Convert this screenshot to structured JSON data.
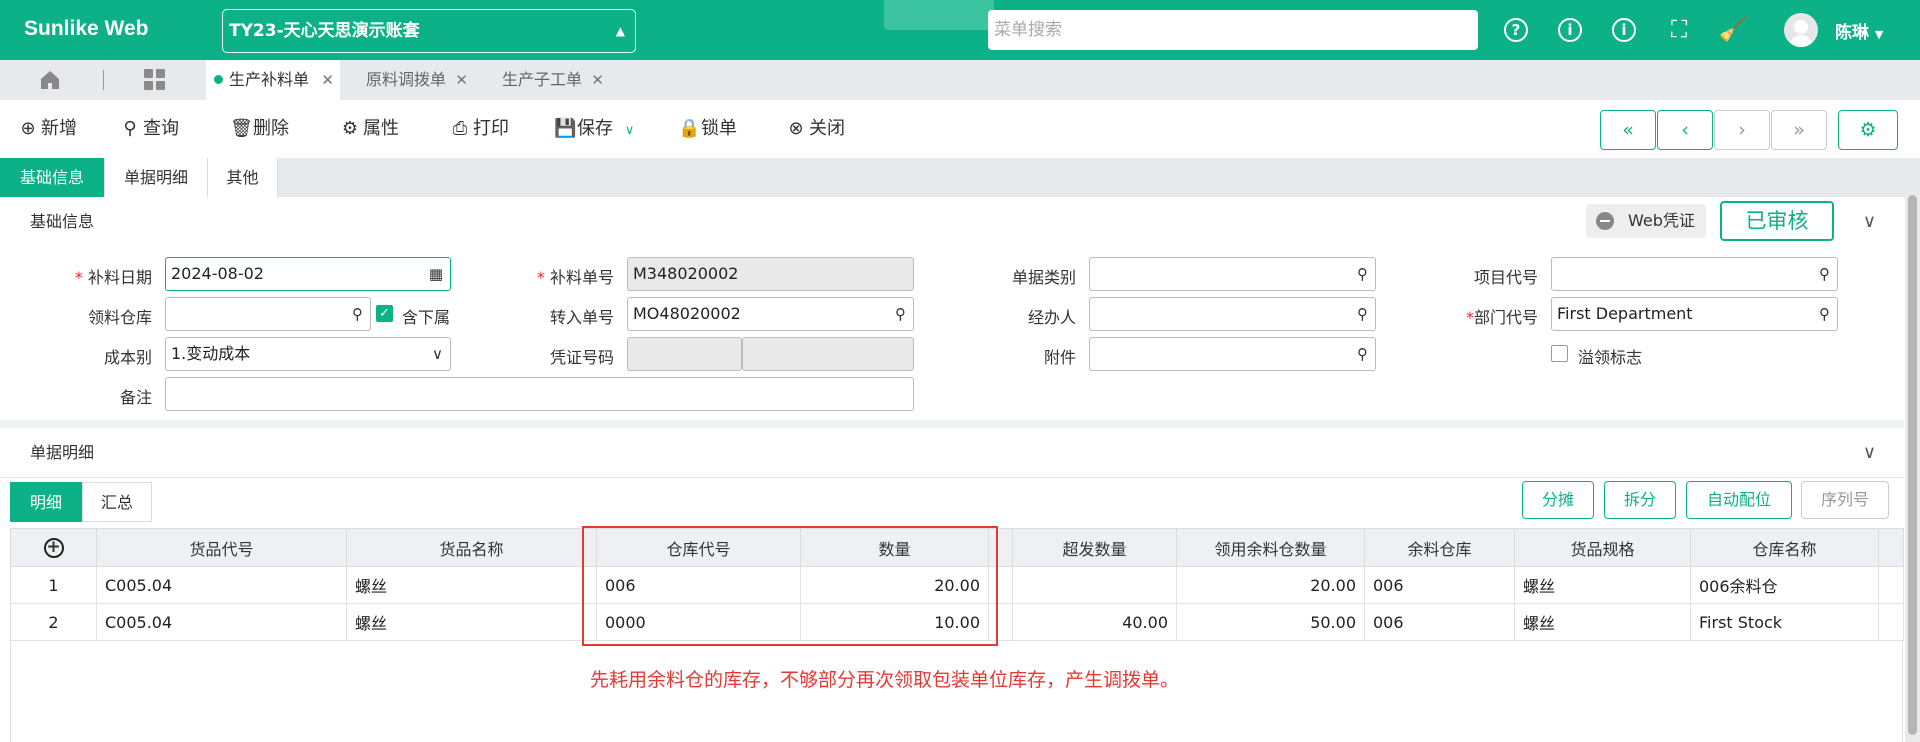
{
  "brand": "Sunlike Web",
  "account": "TY23-天心天思演示账套",
  "menu_search_placeholder": "菜单搜索",
  "user_name": "陈琳",
  "page_tabs": [
    {
      "label": "生产补料单",
      "active": true
    },
    {
      "label": "原料调拨单",
      "active": false
    },
    {
      "label": "生产子工单",
      "active": false
    }
  ],
  "toolbar": {
    "new": "新增",
    "query": "查询",
    "delete": "删除",
    "props": "属性",
    "print": "打印",
    "save": "保存",
    "lock": "锁单",
    "close": "关闭"
  },
  "form_tabs": [
    "基础信息",
    "单据明细",
    "其他"
  ],
  "basic_section": {
    "title": "基础信息",
    "web_voucher": "Web凭证",
    "status": "已审核"
  },
  "fields": {
    "date_label": "补料日期",
    "date_value": "2024-08-02",
    "warehouse_label": "领料仓库",
    "warehouse_value": "",
    "include_sub_label": "含下属",
    "cost_label": "成本别",
    "cost_value": "1.变动成本",
    "remark_label": "备注",
    "remark_value": "",
    "order_no_label": "补料单号",
    "order_no_value": "M348020002",
    "transfer_label": "转入单号",
    "transfer_value": "MO48020002",
    "voucher_label": "凭证号码",
    "doc_type_label": "单据类别",
    "handler_label": "经办人",
    "attach_label": "附件",
    "project_label": "项目代号",
    "dept_label": "部门代号",
    "dept_value": "First Department",
    "overflow_label": "溢领标志"
  },
  "detail_section": {
    "title": "单据明细",
    "tabs": [
      "明细",
      "汇总"
    ],
    "buttons": [
      "分摊",
      "拆分",
      "自动配位",
      "序列号"
    ]
  },
  "table": {
    "headers": [
      "货品代号",
      "货品名称",
      "仓库代号",
      "数量",
      "",
      "超发数量",
      "领用余料仓数量",
      "余料仓库",
      "货品规格",
      "仓库名称"
    ],
    "rows": [
      {
        "no": "1",
        "code": "C005.04",
        "name": "螺丝",
        "wh": "006",
        "qty": "20.00",
        "over": "",
        "rest": "20.00",
        "rest_wh": "006",
        "spec": "螺丝",
        "wh_name": "006余料仓"
      },
      {
        "no": "2",
        "code": "C005.04",
        "name": "螺丝",
        "wh": "0000",
        "qty": "10.00",
        "over": "40.00",
        "rest": "50.00",
        "rest_wh": "006",
        "spec": "螺丝",
        "wh_name": "First Stock"
      }
    ]
  },
  "annotation": "先耗用余料仓的库存，不够部分再次领取包装单位库存，产生调拨单。",
  "colors": {
    "accent": "#0db187",
    "annotation": "#e53935"
  }
}
